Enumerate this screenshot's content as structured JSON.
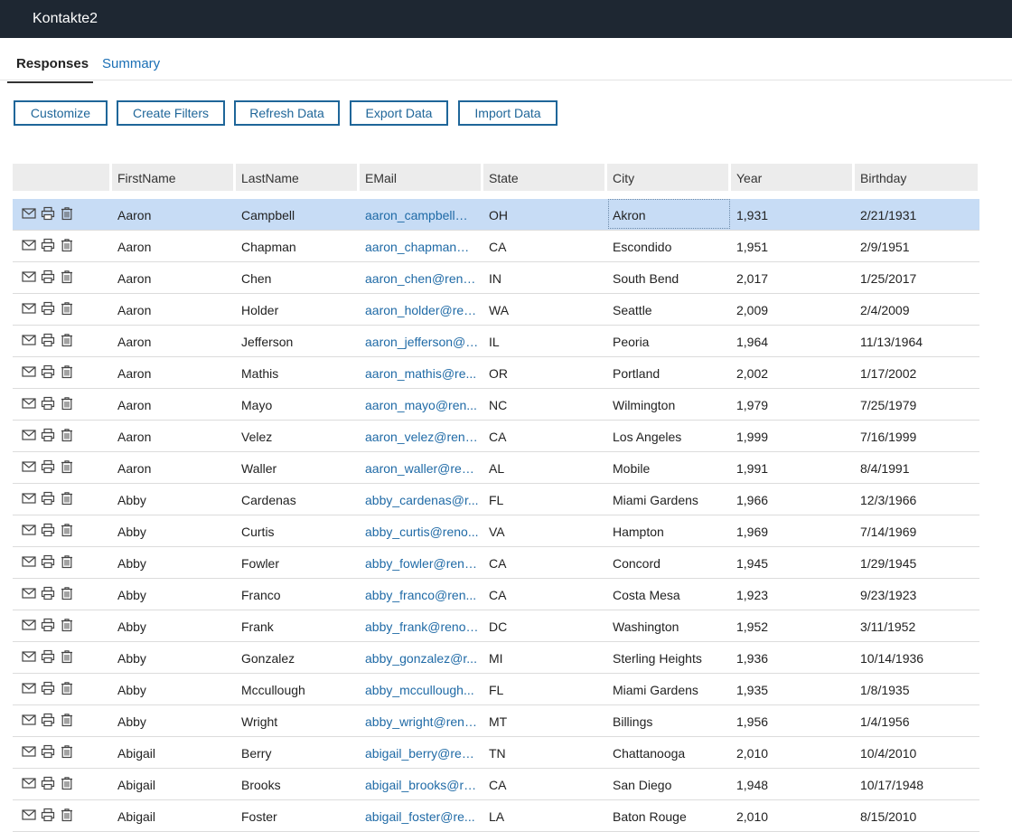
{
  "app": {
    "title": "Kontakte2"
  },
  "tabs": [
    {
      "label": "Responses",
      "active": true
    },
    {
      "label": "Summary",
      "active": false
    }
  ],
  "toolbar": {
    "buttons": [
      "Customize",
      "Create Filters",
      "Refresh Data",
      "Export Data",
      "Import Data"
    ]
  },
  "table": {
    "headers": [
      "FirstName",
      "LastName",
      "EMail",
      "State",
      "City",
      "Year",
      "Birthday"
    ],
    "rows": [
      {
        "first": "Aaron",
        "last": "Campbell",
        "email": "aaron_campbell@r...",
        "state": "OH",
        "city": "Akron",
        "year": "1,931",
        "birthday": "2/21/1931",
        "selected": true
      },
      {
        "first": "Aaron",
        "last": "Chapman",
        "email": "aaron_chapman@...",
        "state": "CA",
        "city": "Escondido",
        "year": "1,951",
        "birthday": "2/9/1951"
      },
      {
        "first": "Aaron",
        "last": "Chen",
        "email": "aaron_chen@reno...",
        "state": "IN",
        "city": "South Bend",
        "year": "2,017",
        "birthday": "1/25/2017"
      },
      {
        "first": "Aaron",
        "last": "Holder",
        "email": "aaron_holder@ren...",
        "state": "WA",
        "city": "Seattle",
        "year": "2,009",
        "birthday": "2/4/2009"
      },
      {
        "first": "Aaron",
        "last": "Jefferson",
        "email": "aaron_jefferson@r...",
        "state": "IL",
        "city": "Peoria",
        "year": "1,964",
        "birthday": "11/13/1964"
      },
      {
        "first": "Aaron",
        "last": "Mathis",
        "email": "aaron_mathis@re...",
        "state": "OR",
        "city": "Portland",
        "year": "2,002",
        "birthday": "1/17/2002"
      },
      {
        "first": "Aaron",
        "last": "Mayo",
        "email": "aaron_mayo@ren...",
        "state": "NC",
        "city": "Wilmington",
        "year": "1,979",
        "birthday": "7/25/1979"
      },
      {
        "first": "Aaron",
        "last": "Velez",
        "email": "aaron_velez@reno...",
        "state": "CA",
        "city": "Los Angeles",
        "year": "1,999",
        "birthday": "7/16/1999"
      },
      {
        "first": "Aaron",
        "last": "Waller",
        "email": "aaron_waller@ren...",
        "state": "AL",
        "city": "Mobile",
        "year": "1,991",
        "birthday": "8/4/1991"
      },
      {
        "first": "Abby",
        "last": "Cardenas",
        "email": "abby_cardenas@r...",
        "state": "FL",
        "city": "Miami Gardens",
        "year": "1,966",
        "birthday": "12/3/1966"
      },
      {
        "first": "Abby",
        "last": "Curtis",
        "email": "abby_curtis@reno...",
        "state": "VA",
        "city": "Hampton",
        "year": "1,969",
        "birthday": "7/14/1969"
      },
      {
        "first": "Abby",
        "last": "Fowler",
        "email": "abby_fowler@reno...",
        "state": "CA",
        "city": "Concord",
        "year": "1,945",
        "birthday": "1/29/1945"
      },
      {
        "first": "Abby",
        "last": "Franco",
        "email": "abby_franco@ren...",
        "state": "CA",
        "city": "Costa Mesa",
        "year": "1,923",
        "birthday": "9/23/1923"
      },
      {
        "first": "Abby",
        "last": "Frank",
        "email": "abby_frank@renov...",
        "state": "DC",
        "city": "Washington",
        "year": "1,952",
        "birthday": "3/11/1952"
      },
      {
        "first": "Abby",
        "last": "Gonzalez",
        "email": "abby_gonzalez@r...",
        "state": "MI",
        "city": "Sterling Heights",
        "year": "1,936",
        "birthday": "10/14/1936"
      },
      {
        "first": "Abby",
        "last": "Mccullough",
        "email": "abby_mccullough...",
        "state": "FL",
        "city": "Miami Gardens",
        "year": "1,935",
        "birthday": "1/8/1935"
      },
      {
        "first": "Abby",
        "last": "Wright",
        "email": "abby_wright@reno...",
        "state": "MT",
        "city": "Billings",
        "year": "1,956",
        "birthday": "1/4/1956"
      },
      {
        "first": "Abigail",
        "last": "Berry",
        "email": "abigail_berry@ren...",
        "state": "TN",
        "city": "Chattanooga",
        "year": "2,010",
        "birthday": "10/4/2010"
      },
      {
        "first": "Abigail",
        "last": "Brooks",
        "email": "abigail_brooks@re...",
        "state": "CA",
        "city": "San Diego",
        "year": "1,948",
        "birthday": "10/17/1948"
      },
      {
        "first": "Abigail",
        "last": "Foster",
        "email": "abigail_foster@re...",
        "state": "LA",
        "city": "Baton Rouge",
        "year": "2,010",
        "birthday": "8/15/2010"
      }
    ]
  },
  "icons": {
    "email": "mail-icon",
    "print": "print-icon",
    "delete": "trash-icon"
  },
  "colors": {
    "topbar": "#1e2732",
    "accent": "#1f6699",
    "link": "#1f6aa6",
    "selected_row": "#c7dcf5"
  }
}
